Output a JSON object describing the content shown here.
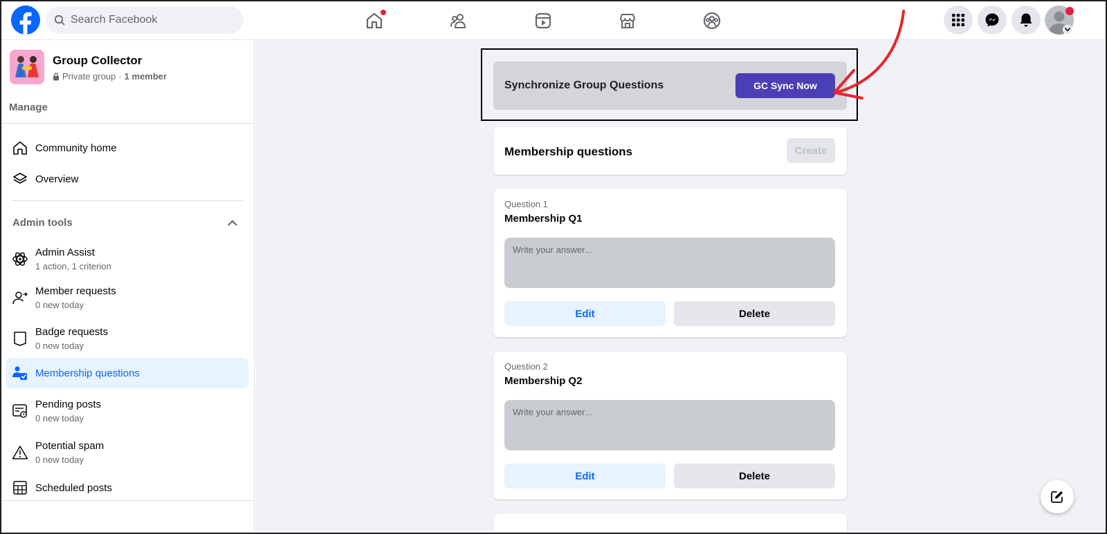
{
  "header": {
    "search_placeholder": "Search Facebook",
    "nav": [
      "home-icon",
      "friends-icon",
      "watch-icon",
      "marketplace-icon",
      "groups-icon"
    ],
    "right": [
      "menu-grid-icon",
      "messenger-icon",
      "notifications-icon",
      "account-avatar"
    ]
  },
  "sidebar": {
    "group_name": "Group Collector",
    "privacy": "Private group",
    "separator": "·",
    "members": "1 member",
    "manage_label": "Manage",
    "nav_items": [
      {
        "label": "Community home"
      },
      {
        "label": "Overview"
      }
    ],
    "admin_tools_label": "Admin tools",
    "admin_items": [
      {
        "label": "Admin Assist",
        "sub": "1 action, 1 criterion"
      },
      {
        "label": "Member requests",
        "sub": "0 new today"
      },
      {
        "label": "Badge requests",
        "sub": "0 new today"
      },
      {
        "label": "Membership questions",
        "sub": ""
      },
      {
        "label": "Pending posts",
        "sub": "0 new today"
      },
      {
        "label": "Potential spam",
        "sub": "0 new today"
      },
      {
        "label": "Scheduled posts",
        "sub": ""
      }
    ]
  },
  "main": {
    "sync_title": "Synchronize Group Questions",
    "sync_button": "GC Sync Now",
    "membership_title": "Membership questions",
    "create_button": "Create",
    "questions": [
      {
        "label": "Question 1",
        "title": "Membership Q1",
        "placeholder": "Write your answer...",
        "edit": "Edit",
        "delete": "Delete"
      },
      {
        "label": "Question 2",
        "title": "Membership Q2",
        "placeholder": "Write your answer...",
        "edit": "Edit",
        "delete": "Delete"
      }
    ]
  },
  "colors": {
    "facebook_blue": "#0866ff",
    "sync_button": "#4b3fb5",
    "annotation_arrow": "#e8242b",
    "notification_dot": "#e41e3f"
  }
}
